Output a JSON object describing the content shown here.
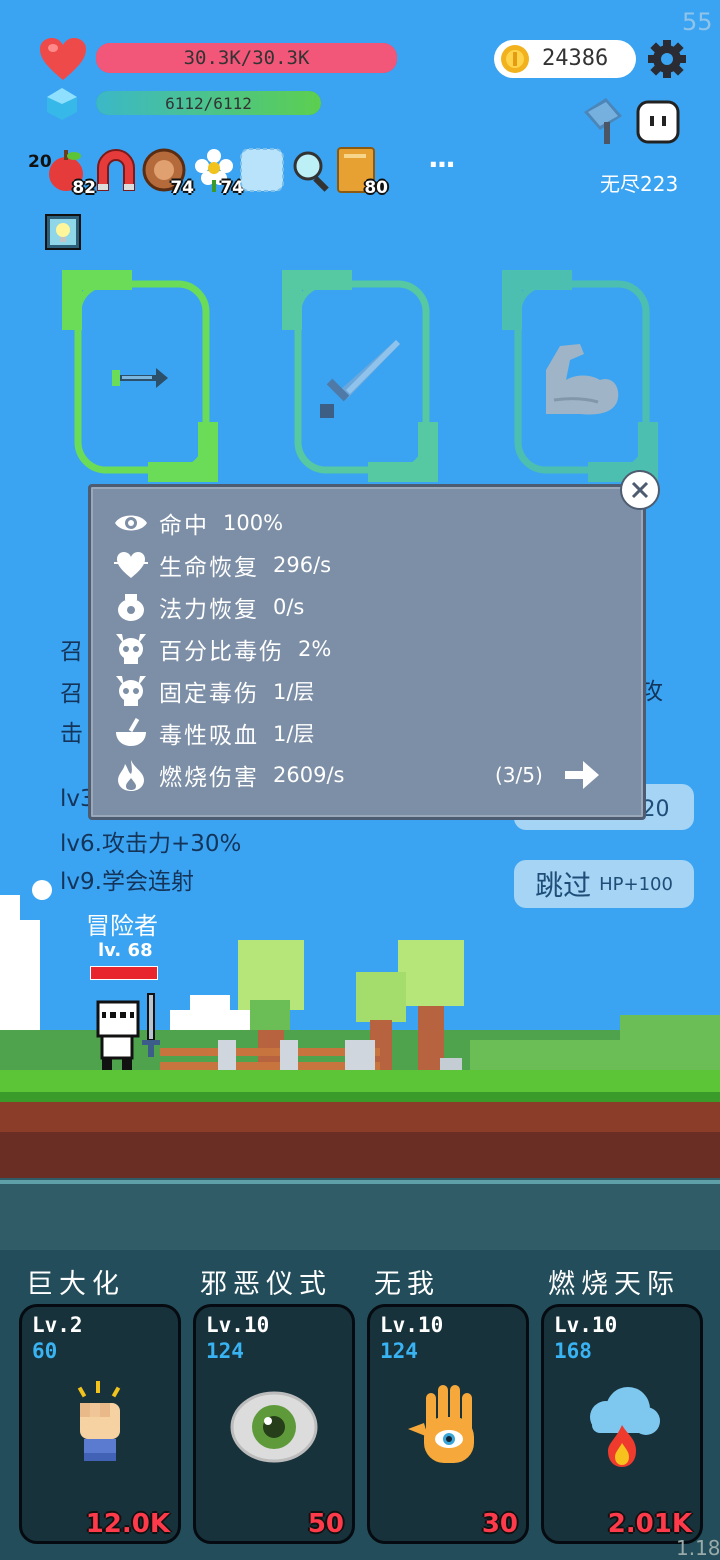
{
  "corner_fps": "55",
  "version": "1.18",
  "hp": {
    "text": "30.3K/30.3K",
    "fill_fraction": 1.0,
    "color": "#f2577a"
  },
  "mp": {
    "text": "6112/6112",
    "fill_fraction": 1.0,
    "color": "#3fc46b"
  },
  "gold": {
    "amount": "24386"
  },
  "mode": {
    "label": "无尽223"
  },
  "items": [
    {
      "icon": "apple-icon",
      "count": "82",
      "prefix": "20"
    },
    {
      "icon": "magnet-icon",
      "count": ""
    },
    {
      "icon": "shield-ring-icon",
      "count": "74"
    },
    {
      "icon": "flower-icon",
      "count": "74"
    },
    {
      "icon": "empty-slot-icon",
      "count": ""
    },
    {
      "icon": "magnifier-icon",
      "count": ""
    },
    {
      "icon": "book-icon",
      "count": "80"
    }
  ],
  "more_label": "···",
  "popup": {
    "rows": [
      {
        "icon": "eye-icon",
        "label": "命中",
        "value": "100%"
      },
      {
        "icon": "heart-regen-icon",
        "label": "生命恢复",
        "value": "296/s"
      },
      {
        "icon": "pot-icon",
        "label": "法力恢复",
        "value": "0/s"
      },
      {
        "icon": "skull-icon",
        "label": "百分比毒伤",
        "value": "2%"
      },
      {
        "icon": "skull-icon",
        "label": "固定毒伤",
        "value": "1/层"
      },
      {
        "icon": "bowl-icon",
        "label": "毒性吸血",
        "value": "1/层"
      },
      {
        "icon": "fire-icon",
        "label": "燃烧伤害",
        "value": "2609/s"
      }
    ],
    "page": "(3/5)"
  },
  "info": {
    "left_fragments": [
      "召",
      "召",
      "击",
      "lv3"
    ],
    "right_fragment": "攻",
    "lines": [
      "lv6.攻击力+30%",
      "lv9.学会连射"
    ]
  },
  "buttons": {
    "refresh_label": "刷新 金币-20",
    "skip_label": "跳过",
    "skip_suffix": "HP+100"
  },
  "hero": {
    "name": "冒险者",
    "level": "lv. 68",
    "hp_fraction": 1.0
  },
  "skills": [
    {
      "name": "巨大化",
      "level": "Lv.2",
      "cost": "60",
      "damage": "12.0K",
      "icon": "fist-icon"
    },
    {
      "name": "邪恶仪式",
      "level": "Lv.10",
      "cost": "124",
      "damage": "50",
      "icon": "evil-eye-icon"
    },
    {
      "name": "无我",
      "level": "Lv.10",
      "cost": "124",
      "damage": "30",
      "icon": "hand-eye-icon"
    },
    {
      "name": "燃烧天际",
      "level": "Lv.10",
      "cost": "168",
      "damage": "2.01K",
      "icon": "fire-cloud-icon"
    }
  ]
}
